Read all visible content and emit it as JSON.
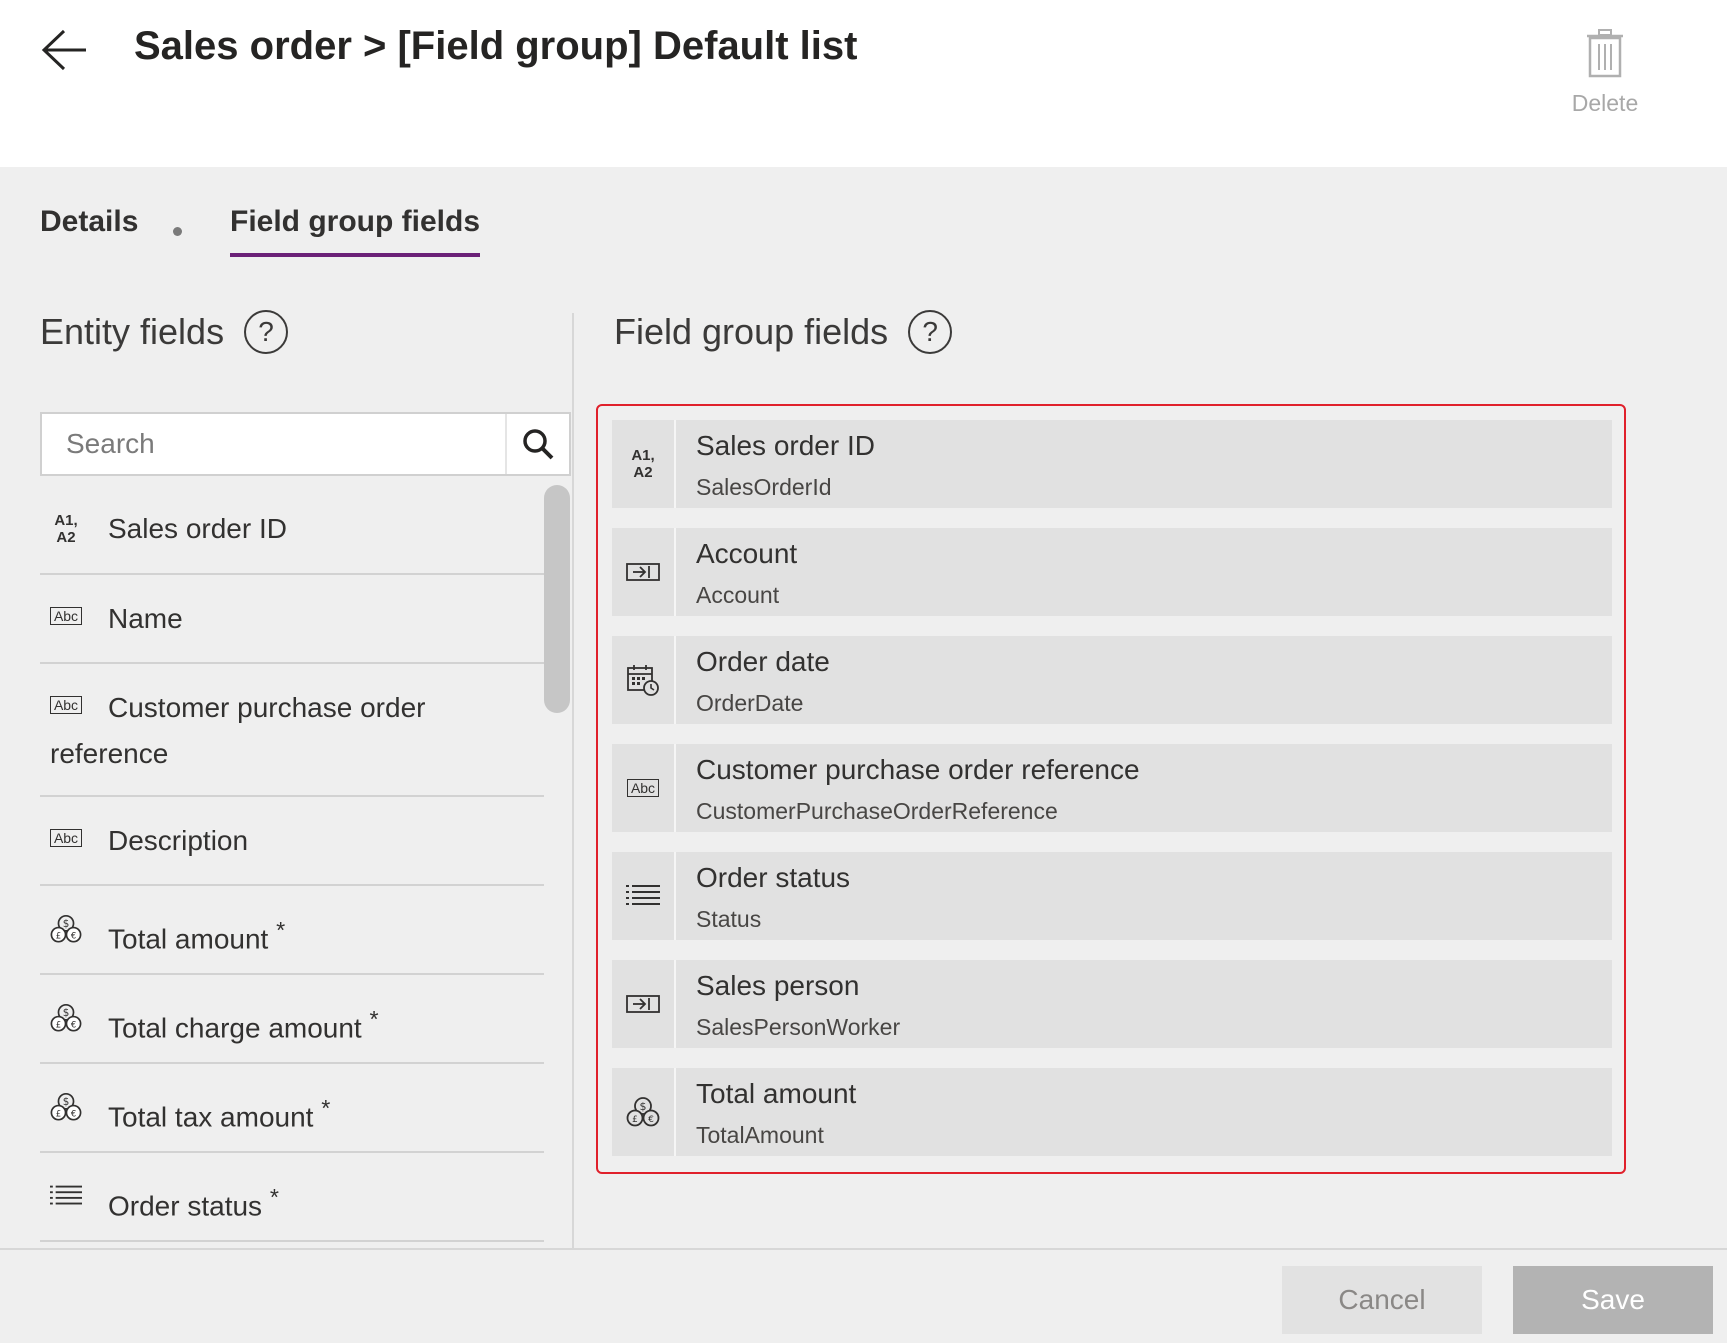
{
  "header": {
    "title": "Sales order > [Field group] Default list",
    "delete_label": "Delete"
  },
  "tabs": [
    {
      "label": "Details"
    },
    {
      "label": "Field group fields"
    }
  ],
  "entity_panel": {
    "title": "Entity fields",
    "search_placeholder": "Search",
    "items": [
      {
        "label": "Sales order ID",
        "icon": "a1-a2-icon"
      },
      {
        "label": "Name",
        "icon": "text-field-icon"
      },
      {
        "label": "Customer purchase order reference",
        "line1": "Customer purchase order",
        "line2": "reference",
        "icon": "text-field-icon"
      },
      {
        "label": "Description",
        "icon": "text-field-icon"
      },
      {
        "label": "Total amount",
        "required": "*",
        "icon": "currency-icon"
      },
      {
        "label": "Total charge amount",
        "required": "*",
        "icon": "currency-icon"
      },
      {
        "label": "Total tax amount",
        "required": "*",
        "icon": "currency-icon"
      },
      {
        "label": "Order status",
        "required": "*",
        "icon": "list-icon"
      }
    ]
  },
  "group_panel": {
    "title": "Field group fields",
    "items": [
      {
        "display_name": "Sales order ID",
        "system_name": "SalesOrderId",
        "icon": "a1-a2-icon"
      },
      {
        "display_name": "Account",
        "system_name": "Account",
        "icon": "lookup-icon"
      },
      {
        "display_name": "Order date",
        "system_name": "OrderDate",
        "icon": "calendar-clock-icon"
      },
      {
        "display_name": "Customer purchase order reference",
        "system_name": "CustomerPurchaseOrderReference",
        "icon": "text-field-icon"
      },
      {
        "display_name": "Order status",
        "system_name": "Status",
        "icon": "list-icon"
      },
      {
        "display_name": "Sales person",
        "system_name": "SalesPersonWorker",
        "icon": "lookup-icon"
      },
      {
        "display_name": "Total amount",
        "system_name": "TotalAmount",
        "icon": "currency-icon"
      }
    ]
  },
  "footer": {
    "cancel_label": "Cancel",
    "save_label": "Save"
  },
  "colors": {
    "accent": "#6b2077",
    "highlight_border": "#e0202b",
    "page_bg": "#efefef",
    "item_bg": "#e1e1e1"
  }
}
